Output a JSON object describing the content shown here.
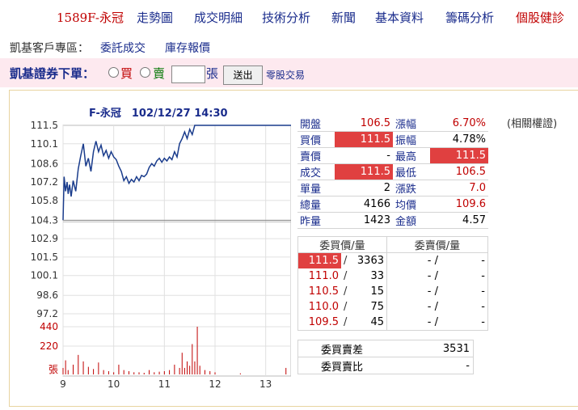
{
  "nav": {
    "stock": "1589F-永冠",
    "items": [
      "走勢圖",
      "成交明細",
      "技術分析",
      "新聞",
      "基本資料",
      "籌碼分析",
      "個股健診"
    ]
  },
  "client": {
    "label": "凱基客戶專區：",
    "link1": "委託成交",
    "link2": "庫存報價"
  },
  "order": {
    "label": "凱基證券下單：",
    "buy": "買",
    "sell": "賣",
    "unit": "張",
    "send": "送出",
    "odd_lot": "零股交易"
  },
  "chart_title": "F-永冠　102/12/27 14:30",
  "chart_data": {
    "type": "line",
    "x_ticks": [
      "9",
      "10",
      "11",
      "12",
      "13"
    ],
    "y_ticks": [
      "111.5",
      "110.1",
      "108.6",
      "107.2",
      "105.8",
      "104.3",
      "102.9",
      "101.5",
      "100.1",
      "98.6",
      "97.2"
    ],
    "volume_ticks": [
      "440",
      "220",
      "張"
    ],
    "prev_close": 104.3,
    "price_range": [
      97.2,
      111.5
    ],
    "price_series": [
      [
        9.0,
        104.3
      ],
      [
        9.02,
        107.6
      ],
      [
        9.05,
        106.5
      ],
      [
        9.08,
        107.2
      ],
      [
        9.1,
        106.3
      ],
      [
        9.13,
        107.0
      ],
      [
        9.16,
        106.1
      ],
      [
        9.2,
        107.3
      ],
      [
        9.25,
        106.5
      ],
      [
        9.3,
        108.2
      ],
      [
        9.35,
        109.2
      ],
      [
        9.4,
        110.1
      ],
      [
        9.45,
        108.4
      ],
      [
        9.5,
        109.0
      ],
      [
        9.55,
        108.0
      ],
      [
        9.6,
        109.5
      ],
      [
        9.65,
        110.3
      ],
      [
        9.7,
        109.5
      ],
      [
        9.75,
        110.0
      ],
      [
        9.8,
        109.2
      ],
      [
        9.85,
        109.6
      ],
      [
        9.9,
        109.0
      ],
      [
        9.95,
        109.5
      ],
      [
        10.0,
        109.1
      ],
      [
        10.05,
        108.9
      ],
      [
        10.1,
        108.4
      ],
      [
        10.15,
        108.0
      ],
      [
        10.2,
        107.3
      ],
      [
        10.25,
        107.6
      ],
      [
        10.3,
        107.1
      ],
      [
        10.35,
        107.4
      ],
      [
        10.4,
        107.2
      ],
      [
        10.45,
        107.6
      ],
      [
        10.5,
        107.3
      ],
      [
        10.55,
        107.7
      ],
      [
        10.6,
        107.6
      ],
      [
        10.65,
        107.8
      ],
      [
        10.7,
        108.3
      ],
      [
        10.75,
        108.6
      ],
      [
        10.8,
        108.4
      ],
      [
        10.85,
        108.8
      ],
      [
        10.9,
        109.0
      ],
      [
        10.95,
        108.7
      ],
      [
        11.0,
        109.0
      ],
      [
        11.05,
        108.8
      ],
      [
        11.1,
        109.1
      ],
      [
        11.15,
        108.9
      ],
      [
        11.2,
        109.5
      ],
      [
        11.25,
        109.1
      ],
      [
        11.3,
        110.1
      ],
      [
        11.35,
        110.5
      ],
      [
        11.4,
        111.0
      ],
      [
        11.45,
        110.5
      ],
      [
        11.5,
        111.2
      ],
      [
        11.55,
        110.8
      ],
      [
        11.6,
        111.5
      ],
      [
        11.65,
        111.5
      ],
      [
        13.5,
        111.5
      ]
    ],
    "volume_series": [
      [
        9.0,
        60
      ],
      [
        9.05,
        130
      ],
      [
        9.1,
        40
      ],
      [
        9.2,
        90
      ],
      [
        9.3,
        180
      ],
      [
        9.4,
        120
      ],
      [
        9.5,
        70
      ],
      [
        9.6,
        50
      ],
      [
        9.7,
        110
      ],
      [
        9.8,
        40
      ],
      [
        9.9,
        30
      ],
      [
        10.0,
        20
      ],
      [
        10.1,
        90
      ],
      [
        10.2,
        40
      ],
      [
        10.3,
        30
      ],
      [
        10.4,
        20
      ],
      [
        10.5,
        20
      ],
      [
        10.6,
        15
      ],
      [
        10.7,
        40
      ],
      [
        10.8,
        20
      ],
      [
        10.9,
        25
      ],
      [
        11.0,
        30
      ],
      [
        11.1,
        40
      ],
      [
        11.2,
        90
      ],
      [
        11.3,
        60
      ],
      [
        11.35,
        200
      ],
      [
        11.4,
        60
      ],
      [
        11.45,
        120
      ],
      [
        11.5,
        80
      ],
      [
        11.55,
        280
      ],
      [
        11.6,
        120
      ],
      [
        11.65,
        440
      ],
      [
        11.7,
        80
      ],
      [
        11.8,
        40
      ],
      [
        11.9,
        30
      ],
      [
        12.0,
        20
      ],
      [
        12.5,
        10
      ],
      [
        13.4,
        60
      ]
    ]
  },
  "quote": [
    {
      "k1": "開盤",
      "v1": "106.5",
      "k2": "漲幅",
      "v2": "6.70%"
    },
    {
      "k1": "買價",
      "v1": "111.5",
      "k2": "振幅",
      "v2": "4.78%"
    },
    {
      "k1": "賣價",
      "v1": "-",
      "k2": "最高",
      "v2": "111.5"
    },
    {
      "k1": "成交",
      "v1": "111.5",
      "k2": "最低",
      "v2": "106.5"
    },
    {
      "k1": "單量",
      "v1": "2",
      "k2": "漲跌",
      "v2": "7.0"
    },
    {
      "k1": "總量",
      "v1": "4166",
      "k2": "均價",
      "v2": "109.6"
    },
    {
      "k1": "昨量",
      "v1": "1423",
      "k2": "金額",
      "v2": "4.57"
    }
  ],
  "book": {
    "bid_head": "委買價/量",
    "ask_head": "委賣價/量",
    "rows": [
      {
        "bp": "111.5",
        "bq": "3363",
        "sp": "-",
        "sq": "-"
      },
      {
        "bp": "111.0",
        "bq": "33",
        "sp": "-",
        "sq": "-"
      },
      {
        "bp": "110.5",
        "bq": "15",
        "sp": "-",
        "sq": "-"
      },
      {
        "bp": "110.0",
        "bq": "75",
        "sp": "-",
        "sq": "-"
      },
      {
        "bp": "109.5",
        "bq": "45",
        "sp": "-",
        "sq": "-"
      }
    ]
  },
  "diff": [
    {
      "k": "委買賣差",
      "v": "3531"
    },
    {
      "k": "委買賣比",
      "v": "-"
    }
  ],
  "warrant": "(相關權證)",
  "colors": {
    "nav_blue": "#1a2c8c",
    "up_red": "#c00000",
    "highlight": "#e04040",
    "order_bg": "#fde9ef"
  }
}
